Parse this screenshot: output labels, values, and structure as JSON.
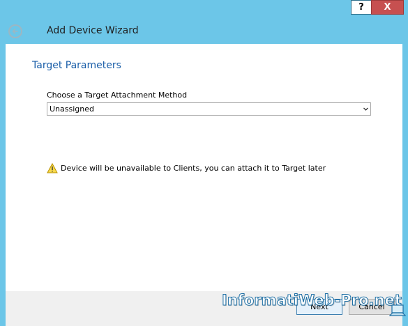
{
  "window": {
    "help_label": "?",
    "close_label": "X"
  },
  "header": {
    "back_icon": "back-arrow-icon",
    "title": "Add Device Wizard"
  },
  "main": {
    "section_title": "Target Parameters",
    "attachment_label": "Choose a Target Attachment Method",
    "attachment_value": "Unassigned",
    "warning_icon": "warning-triangle-icon",
    "warning_text": "Device will be unavailable to Clients, you can attach it to Target later"
  },
  "footer": {
    "next_label": "Next",
    "cancel_label": "Cancel"
  },
  "watermark": {
    "text": "InformatiWeb-Pro.net"
  },
  "colors": {
    "chrome": "#6cc6e8",
    "section_title": "#1a5ea8",
    "close_button": "#c75050"
  }
}
